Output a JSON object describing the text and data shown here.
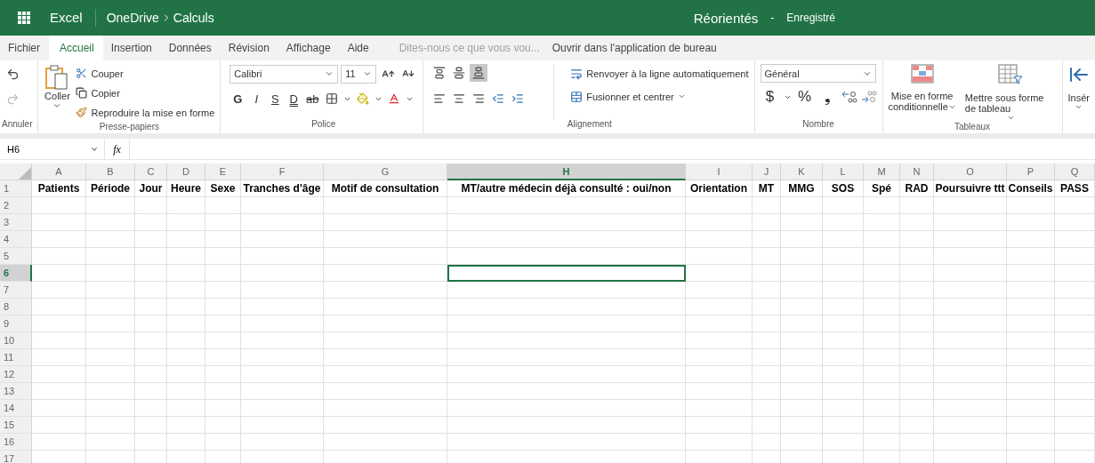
{
  "title_bar": {
    "app": "Excel",
    "breadcrumb": [
      "OneDrive",
      "Calculs"
    ],
    "document": "Réorientés",
    "separator": "-",
    "status": "Enregistré"
  },
  "tabs": [
    {
      "label": "Fichier",
      "selected": false
    },
    {
      "label": "Accueil",
      "selected": true
    },
    {
      "label": "Insertion",
      "selected": false
    },
    {
      "label": "Données",
      "selected": false
    },
    {
      "label": "Révision",
      "selected": false
    },
    {
      "label": "Affichage",
      "selected": false
    },
    {
      "label": "Aide",
      "selected": false
    }
  ],
  "tell_me": {
    "placeholder": "Dites-nous ce que vous vou..."
  },
  "open_desktop": "Ouvrir dans l'application de bureau",
  "ribbon": {
    "undo_group": {
      "label": "Annuler",
      "redo_disabled": true
    },
    "clipboard": {
      "label": "Presse-papiers",
      "paste": "Coller",
      "cut": "Couper",
      "copy": "Copier",
      "format_painter": "Reproduire la mise en forme"
    },
    "font": {
      "label": "Police",
      "family": "Calibri",
      "size": "11",
      "styles": [
        {
          "text": "G",
          "kind": "bold"
        },
        {
          "text": "I",
          "kind": "italic"
        },
        {
          "text": "S",
          "kind": "underline"
        },
        {
          "text": "D",
          "kind": "double"
        },
        {
          "text": "ab",
          "kind": "strike"
        }
      ]
    },
    "alignment": {
      "label": "Alignement",
      "vertical": [
        {
          "selected": false
        },
        {
          "selected": false
        },
        {
          "selected": true
        }
      ],
      "wrap": "Renvoyer à la ligne automatiquement",
      "merge": "Fusionner et centrer"
    },
    "number": {
      "label": "Nombre",
      "format": "Général",
      "currency": "$",
      "percent": "%",
      "thousands": "❟"
    },
    "tables": {
      "label": "Tableaux",
      "conditional": [
        "Mise en forme",
        "conditionnelle"
      ],
      "as_table": "Mettre sous forme de tableau"
    },
    "insert": "Insér"
  },
  "formula_bar": {
    "name_box": "H6",
    "function_label": "fx"
  },
  "columns": [
    {
      "letter": "A",
      "header": "Patients",
      "selected": false
    },
    {
      "letter": "B",
      "header": "Période",
      "selected": false
    },
    {
      "letter": "C",
      "header": "Jour",
      "selected": false
    },
    {
      "letter": "D",
      "header": "Heure",
      "selected": false
    },
    {
      "letter": "E",
      "header": "Sexe",
      "selected": false
    },
    {
      "letter": "F",
      "header": "Tranches d'âge",
      "selected": false
    },
    {
      "letter": "G",
      "header": "Motif de consultation",
      "selected": false
    },
    {
      "letter": "H",
      "header": "MT/autre médecin déjà consulté : oui/non",
      "selected": true
    },
    {
      "letter": "I",
      "header": "Orientation",
      "selected": false
    },
    {
      "letter": "J",
      "header": "MT",
      "selected": false
    },
    {
      "letter": "K",
      "header": "MMG",
      "selected": false
    },
    {
      "letter": "L",
      "header": "SOS",
      "selected": false
    },
    {
      "letter": "M",
      "header": "Spé",
      "selected": false
    },
    {
      "letter": "N",
      "header": "RAD",
      "selected": false
    },
    {
      "letter": "O",
      "header": "Poursuivre ttt",
      "selected": false
    },
    {
      "letter": "P",
      "header": "Conseils",
      "selected": false
    },
    {
      "letter": "Q",
      "header": "PASS",
      "selected": false
    }
  ],
  "rows": [
    {
      "number": "1",
      "selected": false
    },
    {
      "number": "2",
      "selected": false
    },
    {
      "number": "3",
      "selected": false
    },
    {
      "number": "4",
      "selected": false
    },
    {
      "number": "5",
      "selected": false
    },
    {
      "number": "6",
      "selected": true
    },
    {
      "number": "7",
      "selected": false
    },
    {
      "number": "8",
      "selected": false
    },
    {
      "number": "9",
      "selected": false
    },
    {
      "number": "10",
      "selected": false
    },
    {
      "number": "11",
      "selected": false
    },
    {
      "number": "12",
      "selected": false
    },
    {
      "number": "13",
      "selected": false
    },
    {
      "number": "14",
      "selected": false
    },
    {
      "number": "15",
      "selected": false
    },
    {
      "number": "16",
      "selected": false
    },
    {
      "number": "17",
      "selected": false
    }
  ]
}
